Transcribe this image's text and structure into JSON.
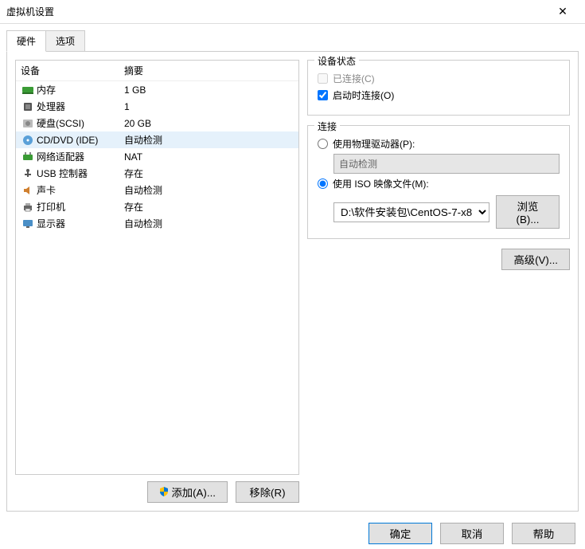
{
  "window": {
    "title": "虚拟机设置"
  },
  "tabs": {
    "hardware": "硬件",
    "options": "选项"
  },
  "hw_header": {
    "device": "设备",
    "summary": "摘要"
  },
  "hardware_list": [
    {
      "icon": "memory",
      "name": "内存",
      "summary": "1 GB",
      "selected": false
    },
    {
      "icon": "cpu",
      "name": "处理器",
      "summary": "1",
      "selected": false
    },
    {
      "icon": "disk",
      "name": "硬盘(SCSI)",
      "summary": "20 GB",
      "selected": false
    },
    {
      "icon": "cd",
      "name": "CD/DVD (IDE)",
      "summary": "自动检测",
      "selected": true
    },
    {
      "icon": "net",
      "name": "网络适配器",
      "summary": "NAT",
      "selected": false
    },
    {
      "icon": "usb",
      "name": "USB 控制器",
      "summary": "存在",
      "selected": false
    },
    {
      "icon": "sound",
      "name": "声卡",
      "summary": "自动检测",
      "selected": false
    },
    {
      "icon": "printer",
      "name": "打印机",
      "summary": "存在",
      "selected": false
    },
    {
      "icon": "display",
      "name": "显示器",
      "summary": "自动检测",
      "selected": false
    }
  ],
  "buttons": {
    "add": "添加(A)...",
    "remove": "移除(R)"
  },
  "device_status": {
    "legend": "设备状态",
    "connected": "已连接(C)",
    "connect_on_start": "启动时连接(O)"
  },
  "connection": {
    "legend": "连接",
    "physical": "使用物理驱动器(P):",
    "auto_detect": "自动检测",
    "use_iso": "使用 ISO 映像文件(M):",
    "iso_path": "D:\\软件安装包\\CentOS-7-x8",
    "browse": "浏览(B)..."
  },
  "advanced": "高级(V)...",
  "dialog_buttons": {
    "ok": "确定",
    "cancel": "取消",
    "help": "帮助"
  }
}
